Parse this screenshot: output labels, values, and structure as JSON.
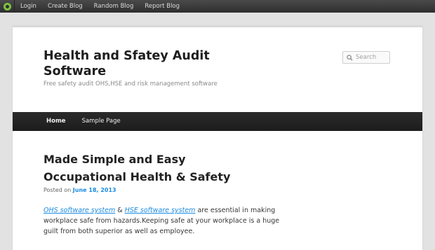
{
  "topbar": {
    "logo_icon": "blog-logo-icon",
    "links": [
      "Login",
      "Create Blog",
      "Random Blog",
      "Report Blog"
    ]
  },
  "header": {
    "site_title": "Health and Sfatey Audit Software",
    "site_description": "Free safety audit OHS,HSE and risk management software",
    "search": {
      "placeholder": "Search",
      "icon": "search-icon"
    }
  },
  "nav": {
    "items": [
      "Home",
      "Sample Page"
    ]
  },
  "post": {
    "title": "Made Simple and Easy Occupational Health & Safety",
    "meta_prefix": "Posted on",
    "date": "June 18, 2013",
    "link1": "OHS software system",
    "amp": "&",
    "link2": "HSE software system",
    "text_after": "are essential in making workplace safe from  hazards.Keeping safe at your workplace is a huge guilt from both superior as well as employee."
  },
  "colors": {
    "link": "#1b8be0",
    "nav_bg": "#222222",
    "topbar_bg": "#3a3a3a",
    "logo": "#7ec241"
  }
}
